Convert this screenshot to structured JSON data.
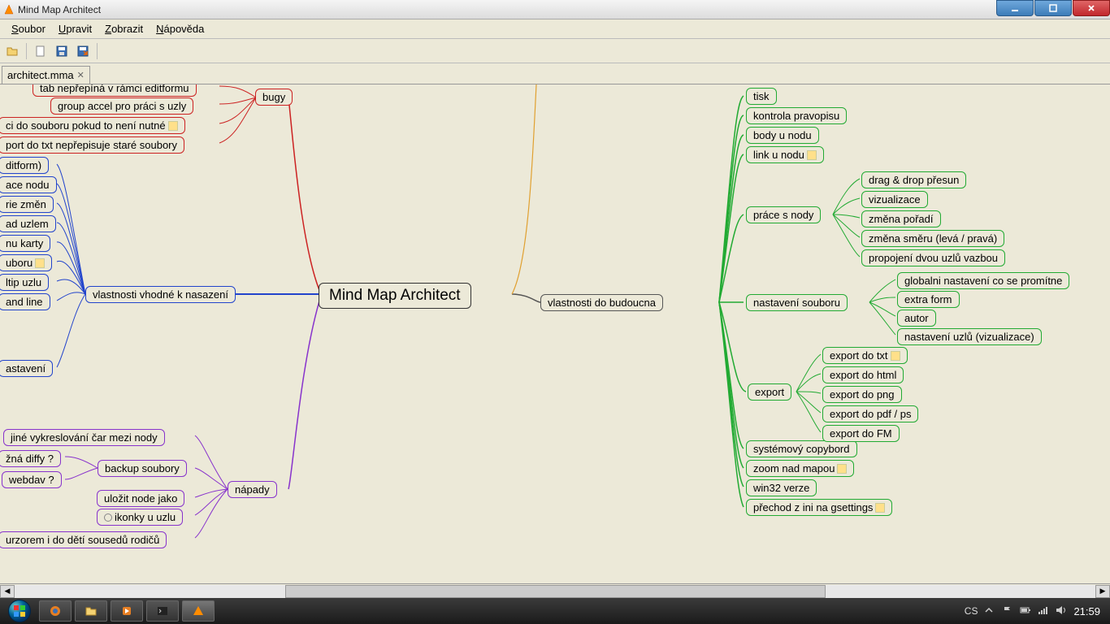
{
  "window": {
    "title": "Mind Map Architect"
  },
  "menu": {
    "soubor": "Soubor",
    "upravit": "Upravit",
    "zobrazit": "Zobrazit",
    "napoveda": "Nápověda"
  },
  "tab": {
    "name": "architect.mma"
  },
  "nodes": {
    "root": "Mind Map Architect",
    "vlastnosti_nasazeni": "vlastnosti vhodné k nasazení",
    "bugy": "bugy",
    "napady": "nápady",
    "vlastnosti_budoucna": "vlastnosti do budoucna",
    "tab_neprepina": "tab nepřepíná v rámci editformu",
    "group_accel": "group accel pro práci s uzly",
    "ci_do_souboru": "ci do souboru pokud to není nutné",
    "port_do_txt": "port do txt nepřepisuje staré soubory",
    "ditform": "ditform)",
    "ace_nodu": "ace nodu",
    "rie_zmen": "rie změn",
    "ad_uzlem": "ad uzlem",
    "nu_karty": "nu karty",
    "uboru": "uboru",
    "itip_uzlu": "ltip uzlu",
    "and_line": "and line",
    "astaveni_left": "astavení",
    "jine_vykreslovani": "jiné vykreslování čar mezi nody",
    "zna_diffy": "žná diffy ?",
    "webdav": "webdav ?",
    "backup_soubory": "backup soubory",
    "ulozit_node": "uložit node jako",
    "ikonky_u_uzlu": "ikonky u uzlu",
    "urzorem": "urzorem i do dětí sousedů rodičů",
    "tisk": "tisk",
    "kontrola_pravopisu": "kontrola pravopisu",
    "body_u_nodu": "body u nodu",
    "link_u_nodu": "link u nodu",
    "prace_s_nody": "práce s nody",
    "drag_drop": "drag & drop přesun",
    "vizualizace": "vizualizace",
    "zmena_poradi": "změna pořadí",
    "zmena_smeru": "změna směru (levá / pravá)",
    "propojeni": "propojení dvou uzlů vazbou",
    "nastaveni_souboru": "nastavení souboru",
    "globalni_nastaveni": "globalni nastavení co se promítne",
    "extra_form": "extra form",
    "autor": "autor",
    "nastaveni_uzlu": "nastavení uzlů (vizualizace)",
    "export": "export",
    "export_txt": "export do txt",
    "export_html": "export do html",
    "export_png": "export do png",
    "export_pdf": "export do pdf / ps",
    "export_fm": "export do FM",
    "systemovy_copybord": "systémový copybord",
    "zoom_nad_mapou": "zoom nad mapou",
    "win32_verze": "win32 verze",
    "prechod_z_ini": "přechod z ini na gsettings"
  },
  "taskbar": {
    "lang": "CS",
    "time": "21:59"
  }
}
